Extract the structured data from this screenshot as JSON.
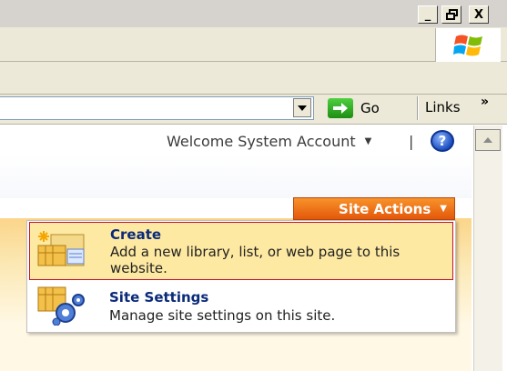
{
  "window": {
    "minimize": "_",
    "maximize": "🗗",
    "close": "X"
  },
  "addressbar": {
    "go_label": "Go",
    "links_label": "Links",
    "links_chevron": "»"
  },
  "header": {
    "welcome_text": "Welcome System Account",
    "separator": "|",
    "help_symbol": "?"
  },
  "site_actions": {
    "label": "Site Actions"
  },
  "menu": {
    "items": [
      {
        "title": "Create",
        "description": "Add a new library, list, or web page to this website.",
        "icon": "create-icon"
      },
      {
        "title": "Site Settings",
        "description": "Manage site settings on this site.",
        "icon": "site-settings-icon"
      }
    ]
  },
  "colors": {
    "site_actions_orange": "#e96a12",
    "menu_highlight": "#fde9a2",
    "menu_highlight_border": "#c8102e",
    "menu_title_blue": "#0a2a7a"
  }
}
